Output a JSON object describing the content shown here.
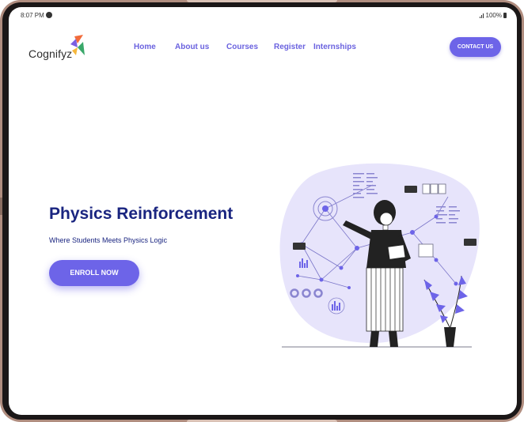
{
  "status_bar": {
    "time": "8:07 PM",
    "battery": "100%"
  },
  "navbar": {
    "logo_text": "Cognifyz",
    "links": [
      "Home",
      "About us",
      "Courses",
      "Register",
      "Internships"
    ],
    "contact_label": "CONTACT US"
  },
  "hero": {
    "title": "Physics Reinforcement",
    "subtitle": "Where Students Meets Physics Logic",
    "cta_label": "ENROLL NOW"
  },
  "colors": {
    "accent": "#6d64e8",
    "title": "#1a2580",
    "blob": "#e7e4fb",
    "device_frame": "#b08d7f"
  },
  "illustration": {
    "icon": "person-with-tablet-network-illustration"
  }
}
